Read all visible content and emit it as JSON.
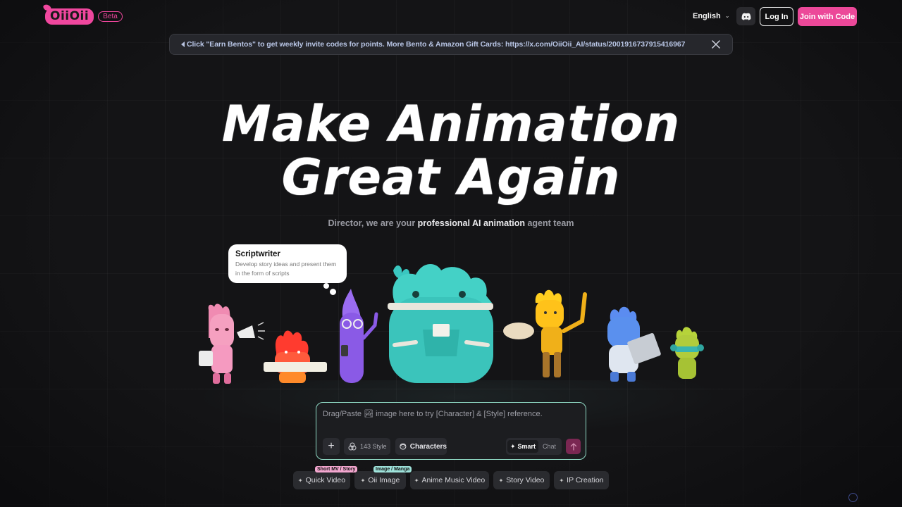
{
  "header": {
    "logo_text": "OiiOii",
    "beta_label": "Beta",
    "language": "English",
    "discord_icon": "discord-icon",
    "login_label": "Log In",
    "join_label": "Join with Code"
  },
  "announcement": {
    "text": "Click \"Earn Bentos\" to get weekly invite codes for points. More Bento & Amazon Gift Cards: https://x.com/OiiOii_AI/status/2001916737915416967",
    "close_icon": "close-icon"
  },
  "hero": {
    "title_line1": "Make Animation",
    "title_line2": "Great Again",
    "subtitle_pre": "Director, we are your ",
    "subtitle_bold": "professional AI animation",
    "subtitle_post": " agent team"
  },
  "bubble": {
    "title": "Scriptwriter",
    "description": "Develop story ideas and present them in the form of scripts"
  },
  "prompt": {
    "placeholder": "Drag/Paste 🏞 image here to try [Character] & [Style] reference.",
    "style_count": "143 Style",
    "characters_label": "Characters",
    "mode_smart": "Smart",
    "mode_chat": "Chat"
  },
  "tabs": [
    {
      "label": "Quick Video",
      "badge": "Short MV / Story"
    },
    {
      "label": "Oii Image",
      "badge": "Image / Manga"
    },
    {
      "label": "Anime Music Video"
    },
    {
      "label": "Story Video"
    },
    {
      "label": "IP Creation"
    }
  ],
  "colors": {
    "accent": "#ec4899",
    "prompt_border": "#8fd9c4",
    "announcement_text": "#b9c6e6"
  }
}
